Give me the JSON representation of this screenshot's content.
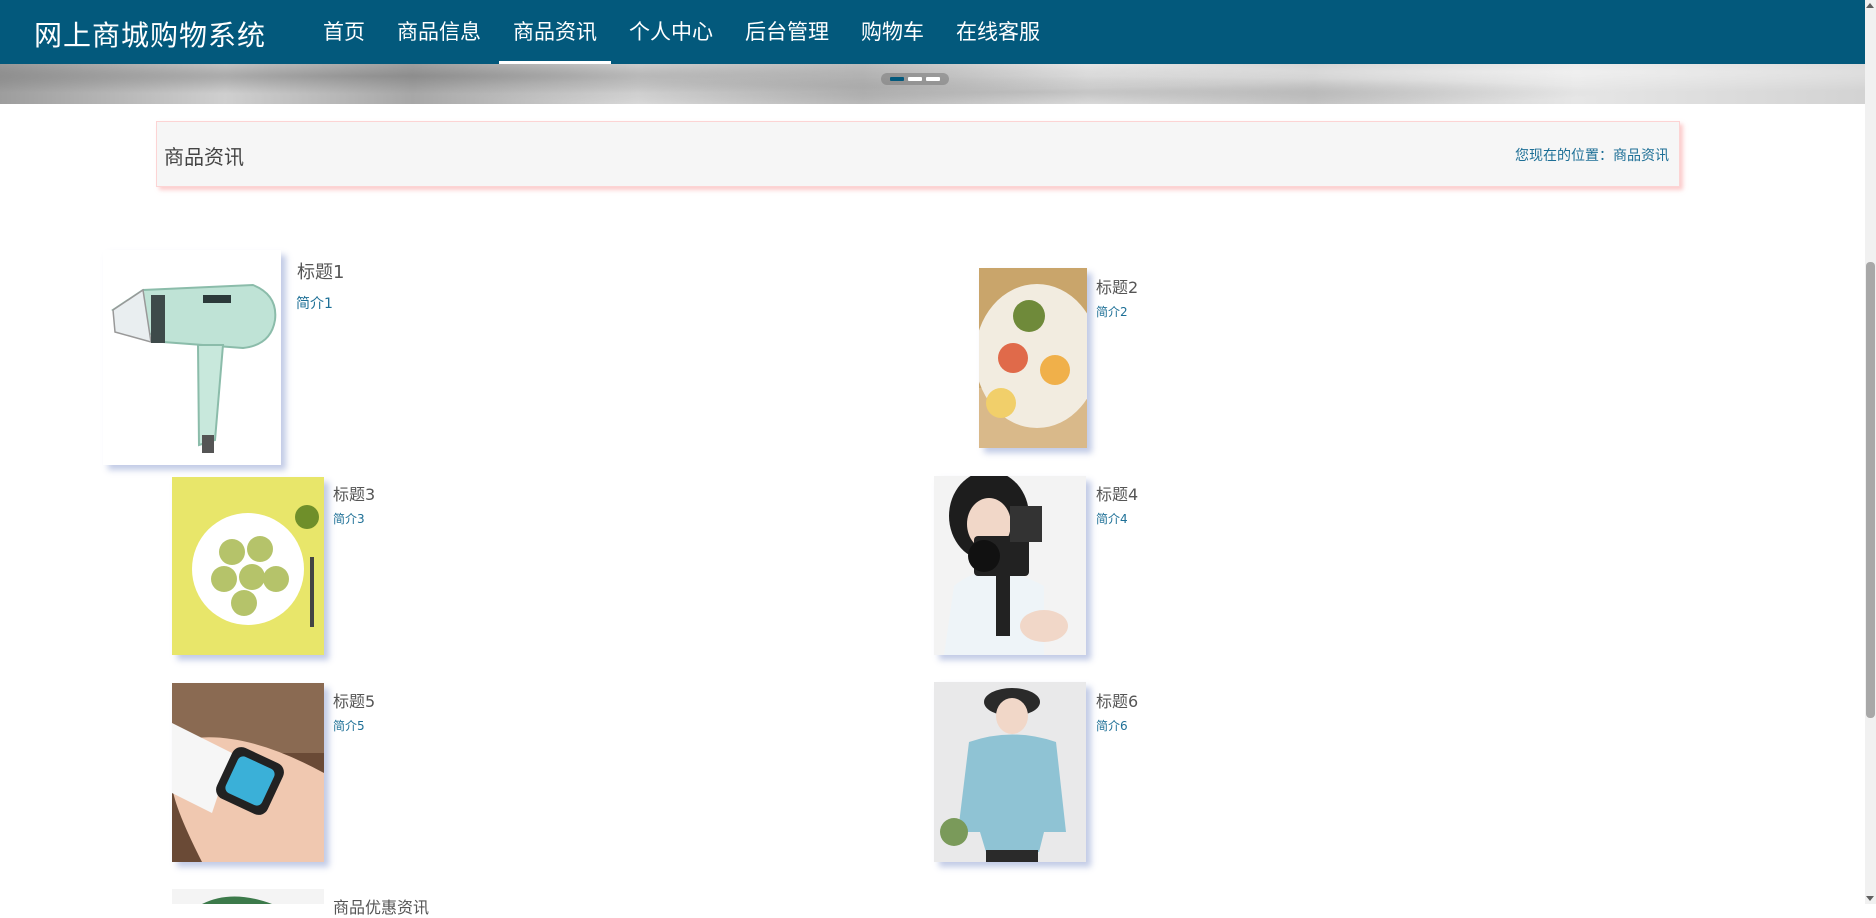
{
  "site": {
    "brand": "网上商城购物系统"
  },
  "nav": {
    "items": [
      {
        "label": "首页"
      },
      {
        "label": "商品信息"
      },
      {
        "label": "商品资讯",
        "active": true
      },
      {
        "label": "个人中心"
      },
      {
        "label": "后台管理"
      },
      {
        "label": "购物车"
      },
      {
        "label": "在线客服"
      }
    ]
  },
  "carousel": {
    "slide_count": 3,
    "active_index": 0
  },
  "breadcrumb": {
    "title": "商品资讯",
    "prefix": "您现在的位置：",
    "current": "商品资讯"
  },
  "news": [
    {
      "title": "标题1",
      "summary": "简介1",
      "image": "hair-dryer-icon"
    },
    {
      "title": "标题2",
      "summary": "简介2",
      "image": "mooncake-plate-icon"
    },
    {
      "title": "标题3",
      "summary": "简介3",
      "image": "matcha-cookie-plate-icon"
    },
    {
      "title": "标题4",
      "summary": "简介4",
      "image": "vlog-camera-icon"
    },
    {
      "title": "标题5",
      "summary": "简介5",
      "image": "smartwatch-icon"
    },
    {
      "title": "标题6",
      "summary": "简介6",
      "image": "hoodie-model-icon"
    },
    {
      "title": "商品优惠资讯",
      "summary": "",
      "image": "leaf-photo-icon"
    }
  ],
  "colors": {
    "nav_bg": "#03597c",
    "link": "#1d6f96",
    "crumb_border": "#fcd4d4"
  }
}
